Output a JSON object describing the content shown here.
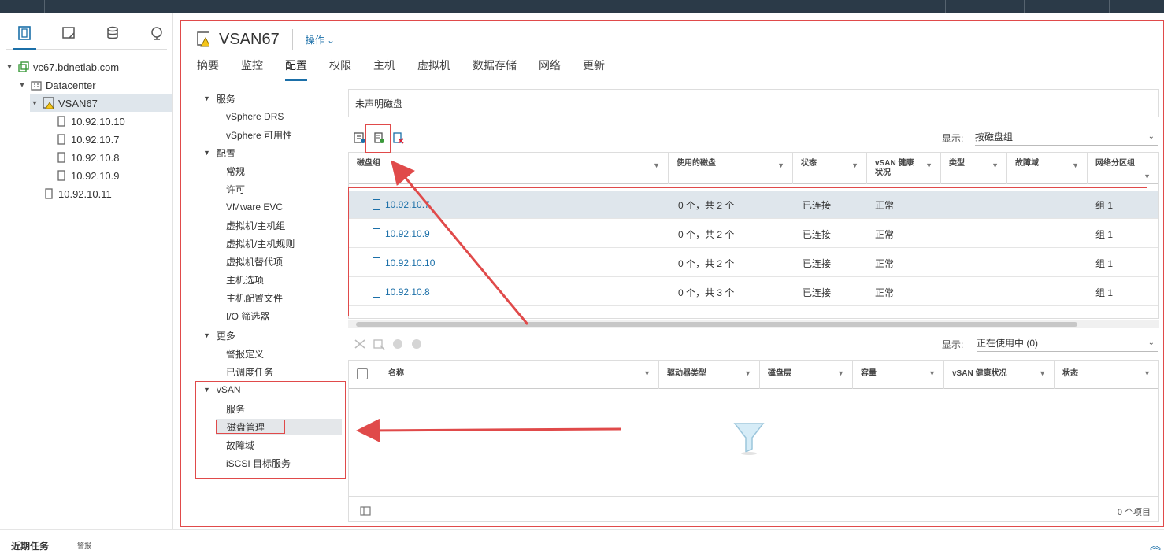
{
  "nav": {
    "tree": [
      {
        "label": "vc67.bdnetlab.com"
      },
      {
        "label": "Datacenter"
      },
      {
        "label": "VSAN67"
      },
      {
        "label": "10.92.10.10"
      },
      {
        "label": "10.92.10.7"
      },
      {
        "label": "10.92.10.8"
      },
      {
        "label": "10.92.10.9"
      },
      {
        "label": "10.92.10.11"
      }
    ]
  },
  "header": {
    "title": "VSAN67",
    "actions": "操作 ⌄"
  },
  "tabs": [
    "摘要",
    "监控",
    "配置",
    "权限",
    "主机",
    "虚拟机",
    "数据存储",
    "网络",
    "更新"
  ],
  "subnav": {
    "services_head": "服务",
    "services": [
      "vSphere DRS",
      "vSphere 可用性"
    ],
    "config_head": "配置",
    "config": [
      "常规",
      "许可",
      "VMware EVC",
      "虚拟机/主机组",
      "虚拟机/主机规则",
      "虚拟机替代项",
      "主机选项",
      "主机配置文件",
      "I/O 筛选器"
    ],
    "more_head": "更多",
    "more": [
      "警报定义",
      "已调度任务"
    ],
    "vsan_head": "vSAN",
    "vsan": [
      "服务",
      "磁盘管理",
      "故障域",
      "iSCSI 目标服务"
    ]
  },
  "content": {
    "section_title": "未声明磁盘",
    "show_label": "显示:",
    "show_value": "按磁盘组",
    "columns": [
      "磁盘组",
      "使用的磁盘",
      "状态",
      "vSAN 健康状况",
      "类型",
      "故障域",
      "网络分区组"
    ],
    "rows": [
      {
        "host": "10.92.10.7",
        "disks": "0 个，共 2 个",
        "state": "已连接",
        "health": "正常",
        "group": "组 1"
      },
      {
        "host": "10.92.10.9",
        "disks": "0 个，共 2 个",
        "state": "已连接",
        "health": "正常",
        "group": "组 1"
      },
      {
        "host": "10.92.10.10",
        "disks": "0 个，共 2 个",
        "state": "已连接",
        "health": "正常",
        "group": "组 1"
      },
      {
        "host": "10.92.10.8",
        "disks": "0 个，共 3 个",
        "state": "已连接",
        "health": "正常",
        "group": "组 1"
      }
    ],
    "show_label2": "显示:",
    "show_value2": "正在使用中 (0)",
    "columns2": [
      "名称",
      "驱动器类型",
      "磁盘层",
      "容量",
      "vSAN 健康状况",
      "状态"
    ],
    "count": "0 个项目"
  },
  "bottom": {
    "recent_tasks": "近期任务",
    "alarms": "警报"
  },
  "colors": {
    "accent": "#1b6fa8",
    "annotation": "#e04a4a"
  }
}
